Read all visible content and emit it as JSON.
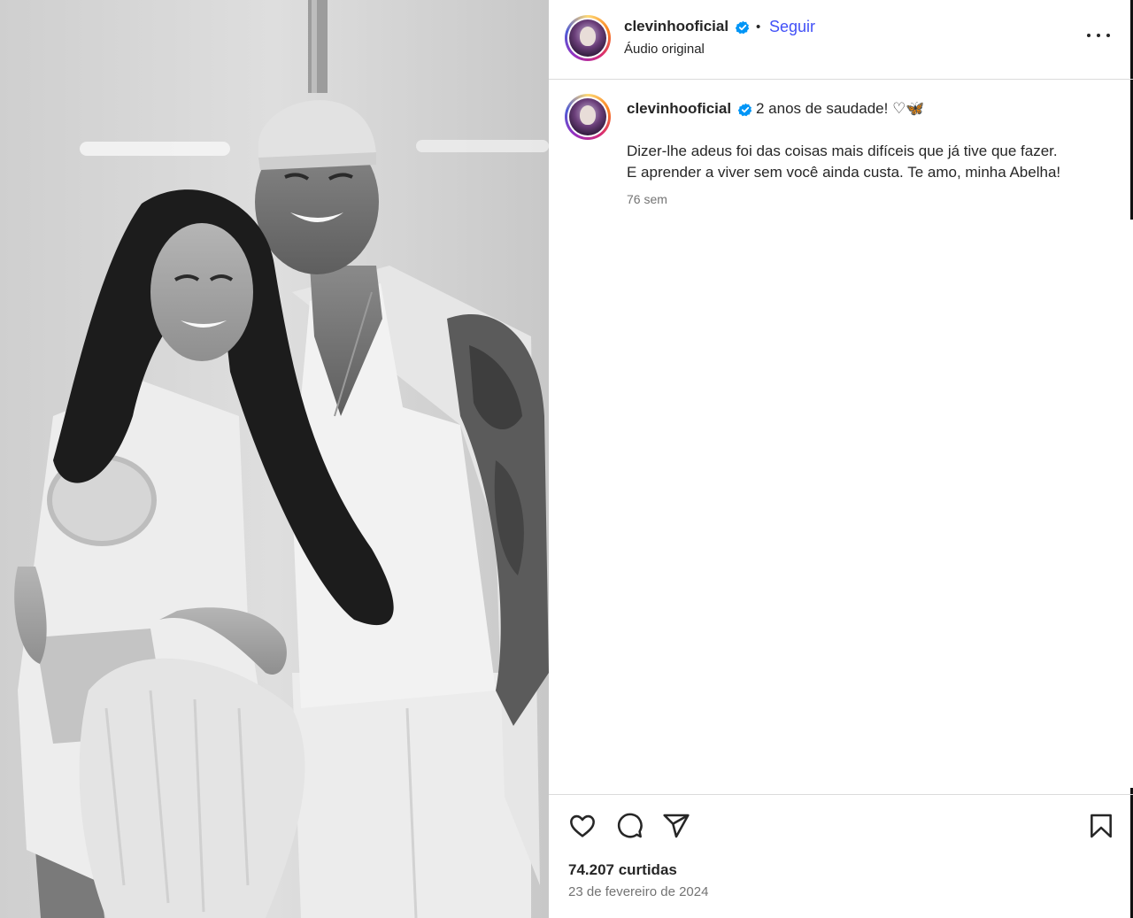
{
  "post": {
    "username": "clevinhooficial",
    "follow_label": "Seguir",
    "separator": "•",
    "audio_label": "Áudio original",
    "more_label": "..."
  },
  "caption": {
    "username": "clevinhooficial",
    "headline": "2 anos de saudade! ♡🦋",
    "line1": "Dizer-lhe adeus foi das coisas mais difíceis que já tive que fazer.",
    "line2": "E aprender a viver sem você ainda custa. Te amo, minha Abelha!",
    "time": "76 sem"
  },
  "actions": {
    "icons": [
      "heart-icon",
      "comment-icon",
      "share-icon",
      "bookmark-icon"
    ],
    "likes": "74.207 curtidas",
    "date": "23 de fevereiro de 2024"
  },
  "colors": {
    "follow": "#4150f7",
    "verified": "#0095f6",
    "text": "#262626",
    "muted": "#737373",
    "border": "#dbdbdb"
  }
}
